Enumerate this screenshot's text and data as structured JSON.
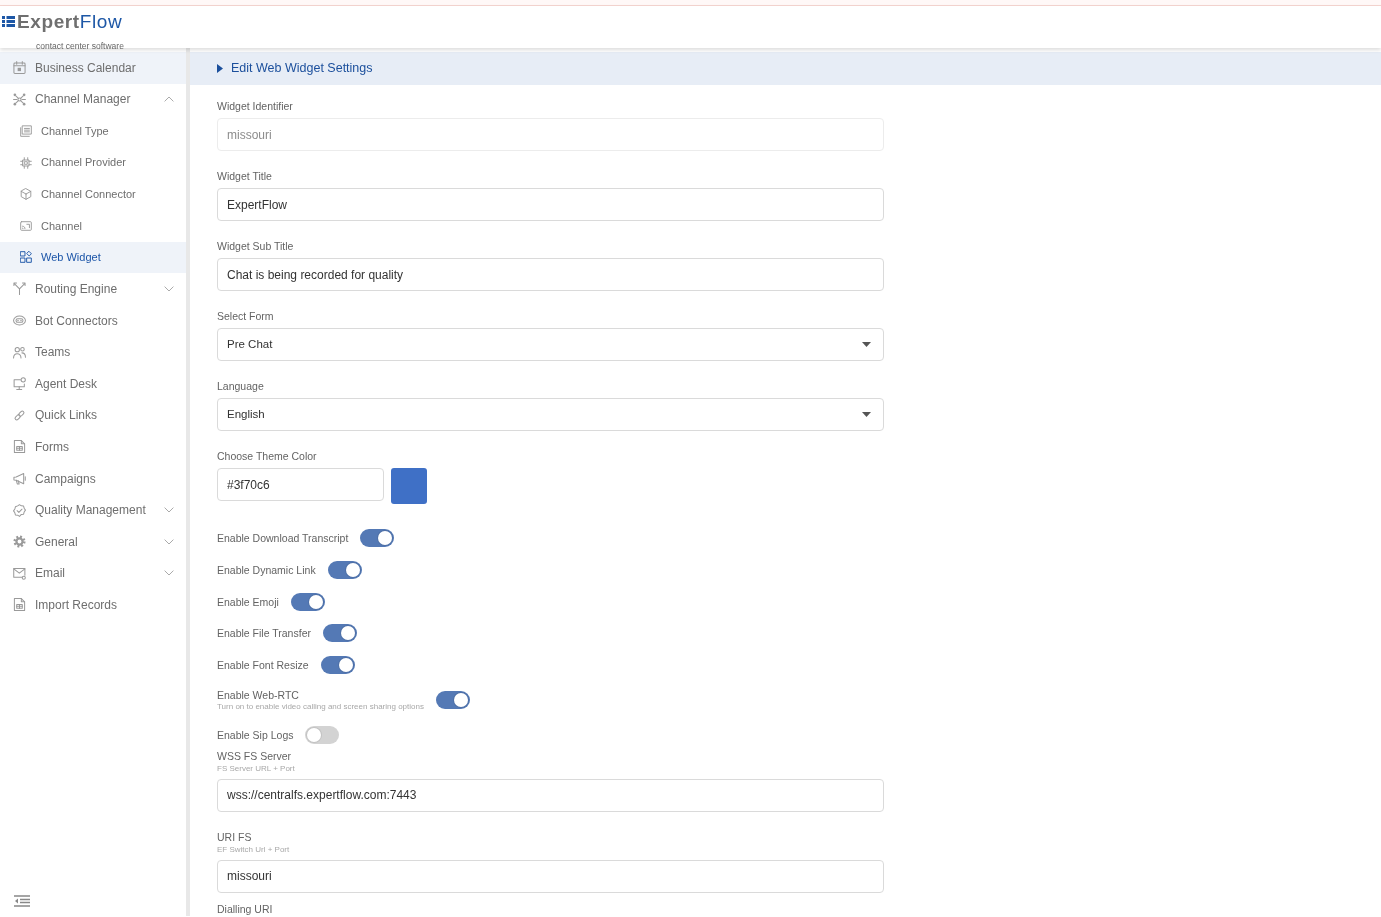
{
  "header": {
    "logo": {
      "wordmark": [
        "Expert",
        "Flow"
      ],
      "tagline": "contact center software"
    }
  },
  "sidebar": {
    "items": [
      {
        "label": "Business Calendar",
        "selected": false,
        "hovered": true
      },
      {
        "label": "Channel Manager",
        "selected": false,
        "hovered": false,
        "expanded": true,
        "children": [
          {
            "label": "Channel Type",
            "selected": false,
            "hovered": false
          },
          {
            "label": "Channel Provider",
            "selected": false,
            "hovered": false
          },
          {
            "label": "Channel Connector",
            "selected": false,
            "hovered": false
          },
          {
            "label": "Channel",
            "selected": false,
            "hovered": false
          },
          {
            "label": "Web Widget",
            "selected": true,
            "hovered": false
          }
        ]
      },
      {
        "label": "Routing Engine",
        "selected": false,
        "hovered": false,
        "expanded": false
      },
      {
        "label": "Bot Connectors",
        "selected": false,
        "hovered": false
      },
      {
        "label": "Teams",
        "selected": false,
        "hovered": false
      },
      {
        "label": "Agent Desk",
        "selected": false,
        "hovered": false
      },
      {
        "label": "Quick Links",
        "selected": false,
        "hovered": false
      },
      {
        "label": "Forms",
        "selected": false,
        "hovered": false
      },
      {
        "label": "Campaigns",
        "selected": false,
        "hovered": false
      },
      {
        "label": "Quality Management",
        "selected": false,
        "hovered": false,
        "expanded": false
      },
      {
        "label": "General",
        "selected": false,
        "hovered": false,
        "expanded": false
      },
      {
        "label": "Email",
        "selected": false,
        "hovered": false,
        "expanded": false
      },
      {
        "label": "Import Records",
        "selected": false,
        "hovered": false
      }
    ]
  },
  "section": {
    "title": "Edit Web Widget Settings"
  },
  "form": {
    "fields": [
      {
        "kind": "text",
        "label": "Widget Identifier",
        "value": "missouri",
        "disabled": true
      },
      {
        "kind": "text",
        "label": "Widget Title",
        "value": "ExpertFlow",
        "disabled": false
      },
      {
        "kind": "text",
        "label": "Widget Sub Title",
        "value": "Chat is being recorded for quality",
        "disabled": false
      },
      {
        "kind": "select",
        "label": "Select Form",
        "value": "Pre Chat"
      },
      {
        "kind": "select",
        "label": "Language",
        "value": "English"
      },
      {
        "kind": "color",
        "label": "Choose Theme Color",
        "value": "#3f70c6",
        "color": "#3f70c6"
      },
      {
        "kind": "toggle",
        "label": "Enable Download Transcript",
        "on": true
      },
      {
        "kind": "toggle",
        "label": "Enable Dynamic Link",
        "on": true
      },
      {
        "kind": "toggle",
        "label": "Enable Emoji",
        "on": true
      },
      {
        "kind": "toggle",
        "label": "Enable File Transfer",
        "on": true
      },
      {
        "kind": "toggle",
        "label": "Enable Font Resize",
        "on": true
      },
      {
        "kind": "toggle",
        "label": "Enable Web-RTC",
        "hint": "Turn on to enable video calling and screen sharing options",
        "on": true
      },
      {
        "kind": "toggle",
        "label": "Enable Sip Logs",
        "on": false
      },
      {
        "kind": "text",
        "label": "WSS FS Server",
        "hint": "FS Server URL + Port",
        "value": "wss://centralfs.expertflow.com:7443",
        "disabled": false
      },
      {
        "kind": "text",
        "label": "URI FS",
        "hint": "EF Switch Url + Port",
        "value": "missouri",
        "disabled": false
      },
      {
        "kind": "text",
        "label": "Dialling URI"
      }
    ]
  }
}
